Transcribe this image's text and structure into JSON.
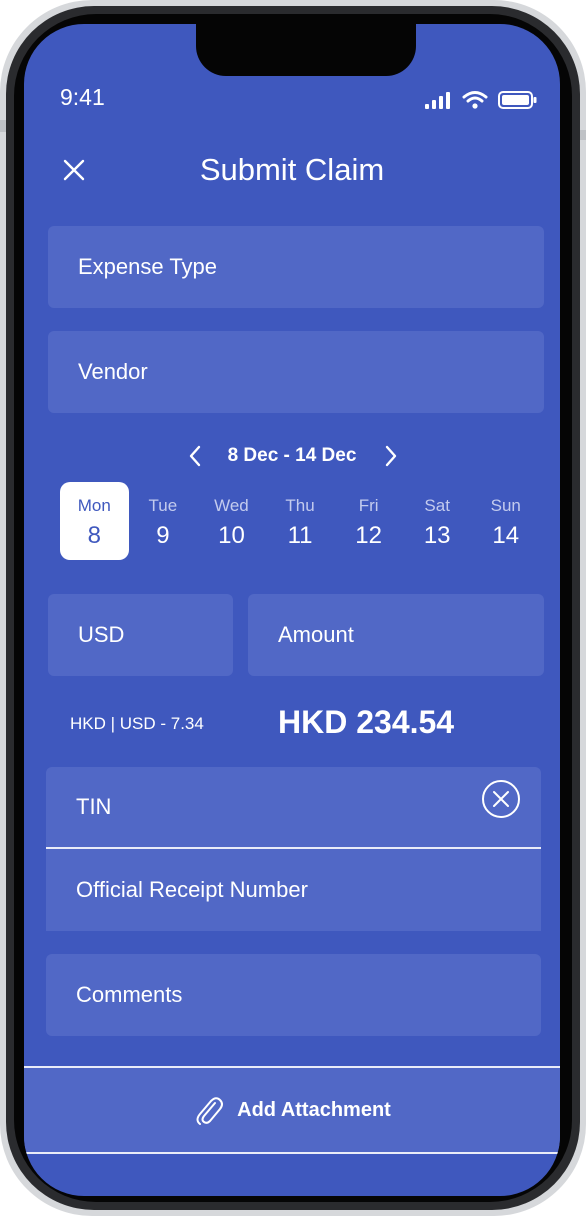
{
  "status": {
    "time": "9:41"
  },
  "header": {
    "title": "Submit Claim"
  },
  "form": {
    "expense_type": "Expense Type",
    "vendor": "Vendor",
    "currency": "USD",
    "amount": "Amount",
    "tin": "TIN",
    "receipt_number": "Official Receipt Number",
    "comments": "Comments"
  },
  "week": {
    "range": "8 Dec - 14 Dec",
    "days": [
      {
        "name": "Mon",
        "num": "8",
        "selected": true
      },
      {
        "name": "Tue",
        "num": "9"
      },
      {
        "name": "Wed",
        "num": "10"
      },
      {
        "name": "Thu",
        "num": "11"
      },
      {
        "name": "Fri",
        "num": "12"
      },
      {
        "name": "Sat",
        "num": "13"
      },
      {
        "name": "Sun",
        "num": "14"
      }
    ]
  },
  "conversion": {
    "rate": "HKD | USD - 7.34",
    "total": "HKD 234.54"
  },
  "attachment": {
    "label": "Add Attachment"
  },
  "colors": {
    "background": "#3f58be",
    "field": "#5168c6",
    "text": "#ffffff"
  }
}
